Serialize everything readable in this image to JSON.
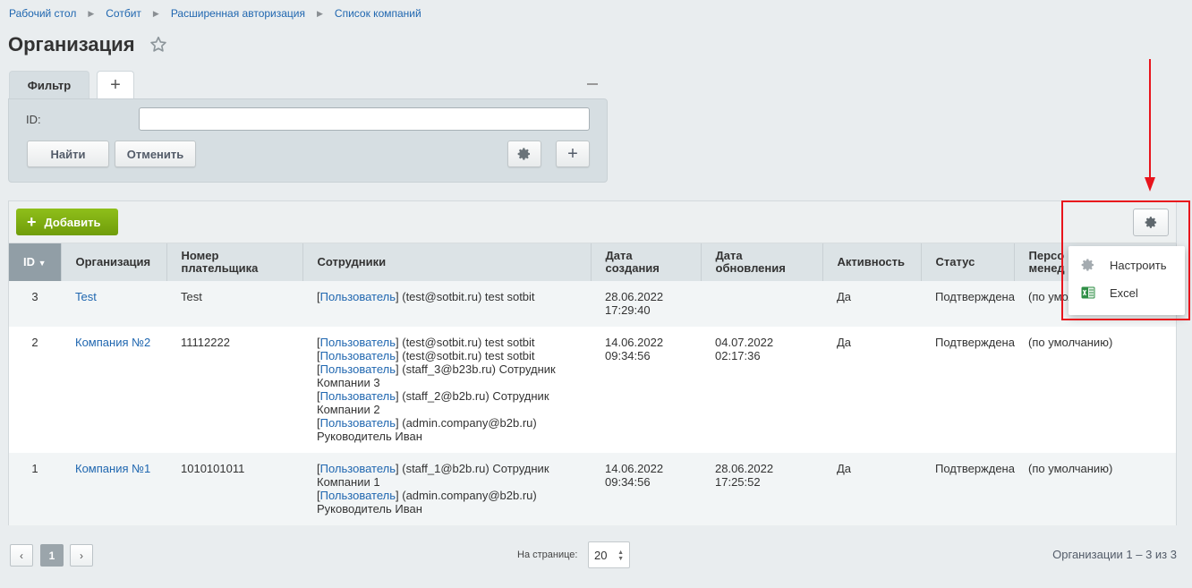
{
  "breadcrumb": [
    "Рабочий стол",
    "Сотбит",
    "Расширенная авторизация",
    "Список компаний"
  ],
  "page_title": "Организация",
  "filter": {
    "tab_label": "Фильтр",
    "add_tab": "+",
    "id_label": "ID:",
    "id_value": "",
    "find_label": "Найти",
    "cancel_label": "Отменить",
    "plus_label": "+"
  },
  "toolbar": {
    "add_label": "Добавить",
    "add_plus": "+"
  },
  "table": {
    "headers": {
      "id": "ID",
      "org": "Организация",
      "payer": [
        "Номер",
        "плательщика"
      ],
      "employees": "Сотрудники",
      "created": [
        "Дата",
        "создания"
      ],
      "updated": [
        "Дата",
        "обновления"
      ],
      "active": "Активность",
      "status": "Статус",
      "manager": [
        "Персо",
        "менед"
      ]
    },
    "user_link": "Пользователь",
    "rows": [
      {
        "id": "3",
        "org": "Test",
        "payer": "Test",
        "employees": [
          {
            "link": "Пользователь",
            "text": " (test@sotbit.ru) test sotbit"
          }
        ],
        "created": [
          "28.06.2022",
          "17:29:40"
        ],
        "updated": "",
        "active": "Да",
        "status": "Подтверждена",
        "manager": "(по умолч"
      },
      {
        "id": "2",
        "org": "Компания №2",
        "payer": "11112222",
        "employees": [
          {
            "link": "Пользователь",
            "text": " (test@sotbit.ru) test sotbit"
          },
          {
            "link": "Пользователь",
            "text": " (test@sotbit.ru) test sotbit"
          },
          {
            "link": "Пользователь",
            "text": " (staff_3@b23b.ru) Сотрудник Компании 3"
          },
          {
            "link": "Пользователь",
            "text": " (staff_2@b2b.ru) Сотрудник Компании 2"
          },
          {
            "link": "Пользователь",
            "text": " (admin.company@b2b.ru) Руководитель Иван"
          }
        ],
        "created": [
          "14.06.2022",
          "09:34:56"
        ],
        "updated": "04.07.2022 02:17:36",
        "active": "Да",
        "status": "Подтверждена",
        "manager": "(по умолчанию)"
      },
      {
        "id": "1",
        "org": "Компания №1",
        "payer": "1010101011",
        "employees": [
          {
            "link": "Пользователь",
            "text": " (staff_1@b2b.ru) Сотрудник Компании 1"
          },
          {
            "link": "Пользователь",
            "text": " (admin.company@b2b.ru) Руководитель Иван"
          }
        ],
        "created": [
          "14.06.2022",
          "09:34:56"
        ],
        "updated": "28.06.2022 17:25:52",
        "active": "Да",
        "status": "Подтверждена",
        "manager": "(по умолчанию)"
      }
    ]
  },
  "menu": {
    "configure": "Настроить",
    "excel": "Excel"
  },
  "pagination": {
    "prev": "‹",
    "current": "1",
    "next": "›",
    "per_page_label": "На странице:",
    "per_page_value": "20",
    "total": "Организации 1 – 3 из 3"
  },
  "colors": {
    "accent_green": "#7bac12",
    "link": "#2067b0",
    "highlight": "#e8141c"
  }
}
